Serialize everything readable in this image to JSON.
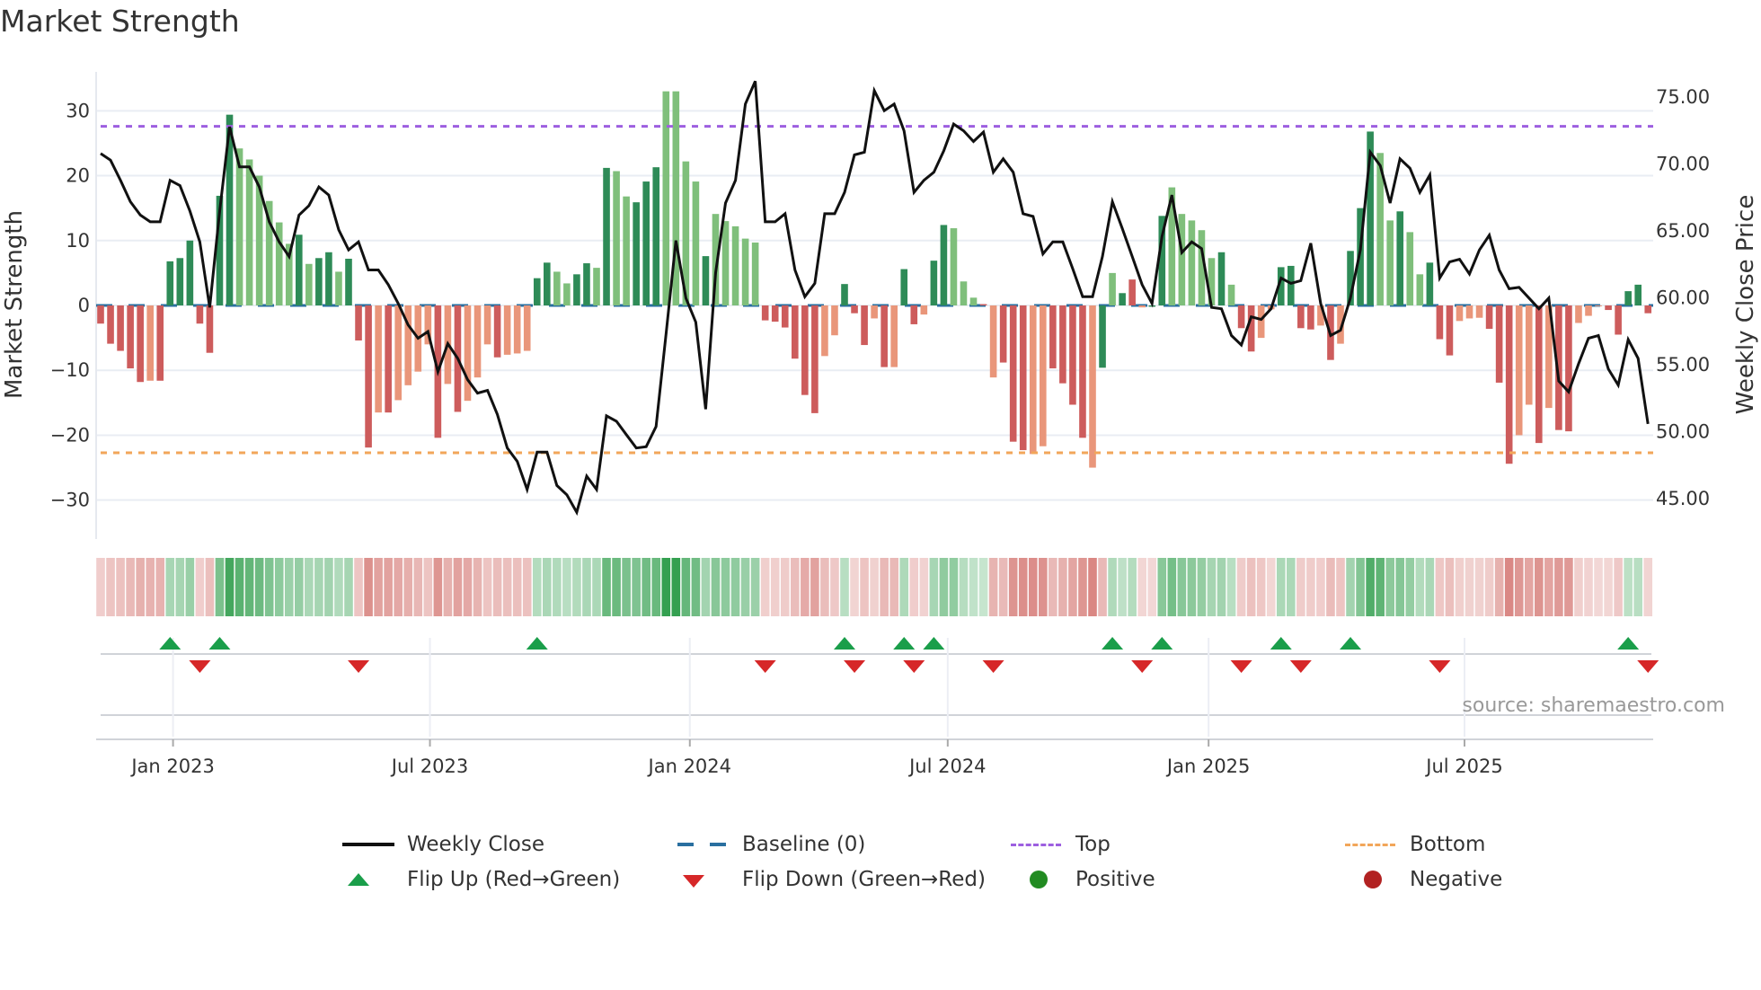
{
  "title": "Market Strength",
  "source": "source: sharemaestro.com",
  "legend": {
    "weekly_close": "Weekly Close",
    "baseline": "Baseline (0)",
    "top": "Top",
    "bottom": "Bottom",
    "flip_up": "Flip Up (Red→Green)",
    "flip_down": "Flip Down (Green→Red)",
    "positive": "Positive",
    "negative": "Negative"
  },
  "colors": {
    "strong_green": "#2e8b57",
    "weak_green": "#7fbf7b",
    "strong_red": "#cd5c5c",
    "weak_red": "#e9967a",
    "line": "#111111",
    "baseline": "#2a6fa0",
    "top": "#9d5fe0",
    "bottom": "#f2a65a",
    "flip_up": "#1a9e4a",
    "flip_down": "#d62728",
    "positive": "#228b22",
    "negative": "#b22222"
  },
  "chart_data": {
    "type": "bar",
    "title": "Market Strength",
    "ylabel": "Market Strength",
    "y2label": "Weekly Close Price",
    "ylim": [
      -36,
      36
    ],
    "y2lim": [
      41.9,
      76.8
    ],
    "yticks": [
      30,
      20,
      10,
      0,
      -10,
      -20,
      -30
    ],
    "yticklabels": [
      "30",
      "20",
      "10",
      "0",
      "−10",
      "−20",
      "−30"
    ],
    "y2ticks": [
      75,
      70,
      65,
      60,
      55,
      50,
      45
    ],
    "y2ticklabels": [
      "75.00",
      "70.00",
      "65.00",
      "60.00",
      "55.00",
      "50.00",
      "45.00"
    ],
    "xticks": [
      7.3,
      33.2,
      59.4,
      85.4,
      111.7,
      137.5
    ],
    "xticklabels": [
      "Jan 2023",
      "Jul 2023",
      "Jan 2024",
      "Jul 2024",
      "Jan 2025",
      "Jul 2025"
    ],
    "top_level": 27.6,
    "bottom_level": -22.7,
    "baseline": 0,
    "strength": [
      -2.8,
      -5.9,
      -7.0,
      -9.7,
      -11.8,
      -11.6,
      -11.6,
      6.8,
      7.3,
      10.0,
      -2.8,
      -7.3,
      16.9,
      29.4,
      24.2,
      22.5,
      20.0,
      16.1,
      12.8,
      9.5,
      10.9,
      6.4,
      7.3,
      8.2,
      5.2,
      7.2,
      -5.4,
      -21.9,
      -16.5,
      -16.5,
      -14.6,
      -12.3,
      -10.2,
      -6.0,
      -20.4,
      -12.1,
      -16.4,
      -14.7,
      -11.1,
      -6.0,
      -8.0,
      -7.6,
      -7.4,
      -7.0,
      4.2,
      6.6,
      5.2,
      3.4,
      4.8,
      6.5,
      5.8,
      21.2,
      20.7,
      16.8,
      15.9,
      19.1,
      21.3,
      33.0,
      33.0,
      22.2,
      19.1,
      7.6,
      14.1,
      13.0,
      12.2,
      10.3,
      9.7,
      -2.3,
      -2.5,
      -3.4,
      -8.2,
      -13.8,
      -16.6,
      -7.8,
      -4.6,
      3.3,
      -1.2,
      -6.1,
      -2.0,
      -9.5,
      -9.5,
      5.6,
      -2.9,
      -1.4,
      6.9,
      12.4,
      11.9,
      3.7,
      1.2,
      0.2,
      -11.1,
      -8.8,
      -21.0,
      -22.3,
      -22.9,
      -21.7,
      -9.7,
      -12.0,
      -15.3,
      -20.4,
      -25.0,
      -9.6,
      5.0,
      1.9,
      4.0,
      -0.3,
      -0.2,
      13.8,
      18.2,
      14.1,
      13.1,
      11.6,
      7.3,
      8.2,
      3.2,
      -3.5,
      -7.1,
      -5.0,
      -0.6,
      5.9,
      6.1,
      -3.5,
      -3.7,
      -3.1,
      -8.4,
      -5.9,
      8.4,
      15.0,
      26.8,
      23.5,
      13.1,
      14.5,
      11.3,
      4.8,
      6.6,
      -5.2,
      -7.7,
      -2.4,
      -2.0,
      -1.9,
      -3.6,
      -11.9,
      -24.4,
      -20.0,
      -15.3,
      -21.2,
      -15.8,
      -19.2,
      -19.4,
      -2.7,
      -1.6,
      -0.1,
      -0.7,
      -4.5,
      2.2,
      3.2,
      -1.2
    ],
    "strength_class": "RRRRRrRGGGRRGGggggggGgGGgGRRrRrrrrRrRrrrRrrrGGggGGgGggGGGggggGgggggRRRRRRrrGRRrRrGRrGGgggRrRRRrrRRRRrGgGRrGGgggggGgRRrrGGRRrRrGGGggGggGRRrrrRRRrrRrRRrrrRRGGR",
    "weekly_close": [
      70.7,
      70.2,
      68.7,
      67.1,
      66.1,
      65.6,
      65.6,
      68.7,
      68.3,
      66.4,
      64.1,
      59.2,
      66.4,
      72.7,
      69.7,
      69.7,
      68.2,
      65.6,
      64.1,
      63.0,
      66.1,
      66.8,
      68.2,
      67.6,
      65.0,
      63.5,
      64.1,
      62.0,
      62.0,
      60.9,
      59.5,
      57.9,
      56.9,
      57.4,
      54.4,
      56.5,
      55.4,
      53.8,
      52.8,
      53.0,
      51.2,
      48.7,
      47.7,
      45.6,
      48.4,
      48.4,
      45.9,
      45.2,
      43.9,
      46.6,
      45.6,
      51.1,
      50.7,
      49.7,
      48.7,
      48.8,
      50.3,
      57.2,
      64.2,
      59.9,
      58.1,
      51.6,
      61.8,
      67.0,
      68.7,
      74.4,
      76.1,
      65.6,
      65.6,
      66.2,
      62.0,
      60.0,
      61.0,
      66.2,
      66.2,
      67.8,
      70.6,
      70.8,
      75.4,
      73.9,
      74.4,
      72.4,
      67.8,
      68.7,
      69.3,
      70.9,
      72.9,
      72.4,
      71.6,
      72.3,
      69.3,
      70.3,
      69.3,
      66.2,
      66.0,
      63.2,
      64.1,
      64.1,
      62.1,
      60.0,
      60.0,
      63.0,
      67.1,
      65.1,
      63.0,
      60.9,
      59.5,
      64.5,
      67.6,
      63.3,
      64.1,
      63.6,
      59.2,
      59.1,
      57.1,
      56.4,
      58.5,
      58.3,
      59.1,
      61.4,
      61.0,
      61.2,
      64.0,
      59.5,
      57.1,
      57.5,
      59.9,
      63.5,
      70.8,
      69.8,
      67.0,
      70.3,
      69.6,
      67.8,
      69.1,
      61.4,
      62.6,
      62.8,
      61.7,
      63.5,
      64.6,
      62.0,
      60.6,
      60.7,
      59.9,
      59.1,
      59.9,
      53.7,
      52.9,
      55.0,
      56.9,
      57.1,
      54.6,
      53.4,
      56.8,
      55.4,
      50.5
    ],
    "flip_up_weeks": [
      7,
      12,
      44,
      75,
      81,
      84,
      102,
      107,
      119,
      126,
      154
    ],
    "flip_down_weeks": [
      10,
      26,
      67,
      76,
      82,
      90,
      105,
      115,
      121,
      135,
      156
    ],
    "legend_placement": "bottom-center",
    "grid": true
  }
}
